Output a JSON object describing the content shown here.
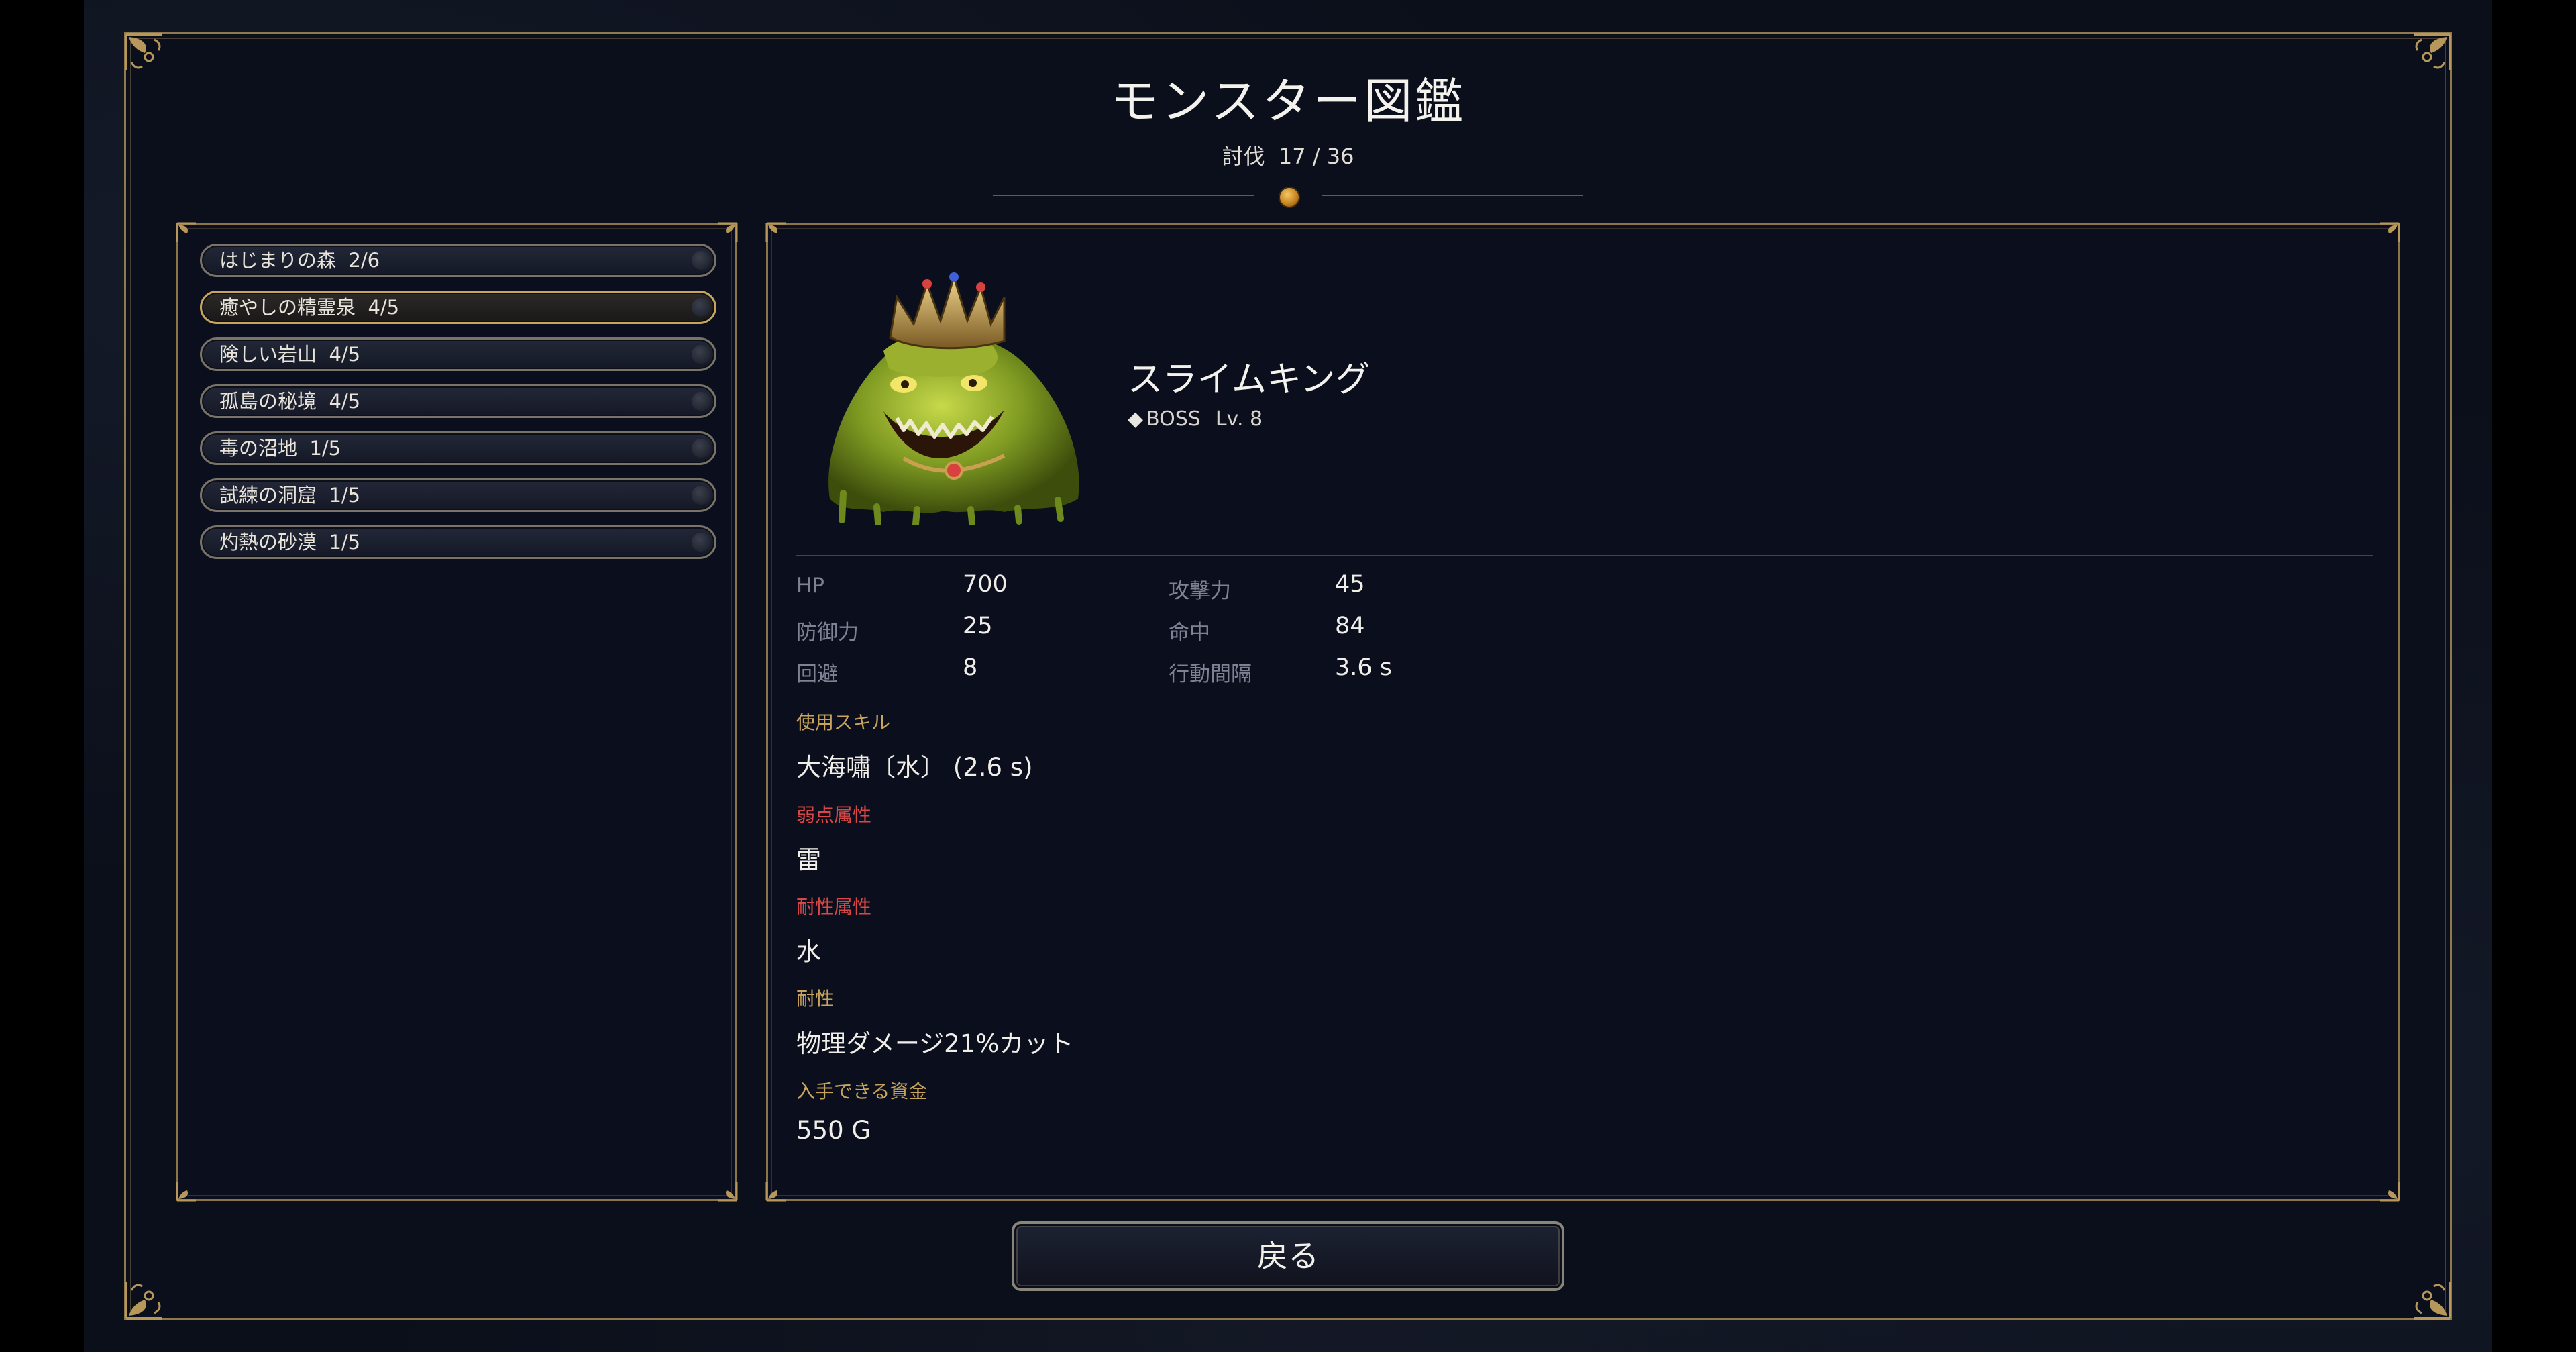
{
  "header": {
    "title": "モンスター図鑑",
    "kill_count_label": "討伐",
    "kill_count": "17 / 36"
  },
  "areas": [
    {
      "name": "はじまりの森",
      "progress": "2/6"
    },
    {
      "name": "癒やしの精霊泉",
      "progress": "4/5",
      "selected": true
    },
    {
      "name": "険しい岩山",
      "progress": "4/5"
    },
    {
      "name": "孤島の秘境",
      "progress": "4/5"
    },
    {
      "name": "毒の沼地",
      "progress": "1/5"
    },
    {
      "name": "試練の洞窟",
      "progress": "1/5"
    },
    {
      "name": "灼熱の砂漠",
      "progress": "1/5"
    }
  ],
  "monster": {
    "name": "スライムキング",
    "tag_marker": "◆",
    "rank": "BOSS",
    "level": "Lv. 8",
    "image_icon": "slime-king-portrait"
  },
  "stats": {
    "hp_label": "HP",
    "hp": "700",
    "attack_label": "攻撃力",
    "attack": "45",
    "defense_label": "防御力",
    "defense": "25",
    "accuracy_label": "命中",
    "accuracy": "84",
    "evasion_label": "回避",
    "evasion": "8",
    "action_interval_label": "行動間隔",
    "action_interval": "3.6 s"
  },
  "skills": {
    "label": "使用スキル",
    "value": "大海嘯〔水〕 (2.6 s)"
  },
  "weakness": {
    "label": "弱点属性",
    "value": "雷"
  },
  "resistance_element": {
    "label": "耐性属性",
    "value": "水"
  },
  "resistance": {
    "label": "耐性",
    "value": "物理ダメージ21%カット"
  },
  "gold_drop": {
    "label": "入手できる資金",
    "value": "550 G"
  },
  "footer": {
    "back_label": "戻る"
  },
  "colors": {
    "gold_accent": "#c9a55b",
    "weakness_red": "#d84848",
    "frame": "#8f7a4e",
    "background": "#0b0f1c"
  }
}
